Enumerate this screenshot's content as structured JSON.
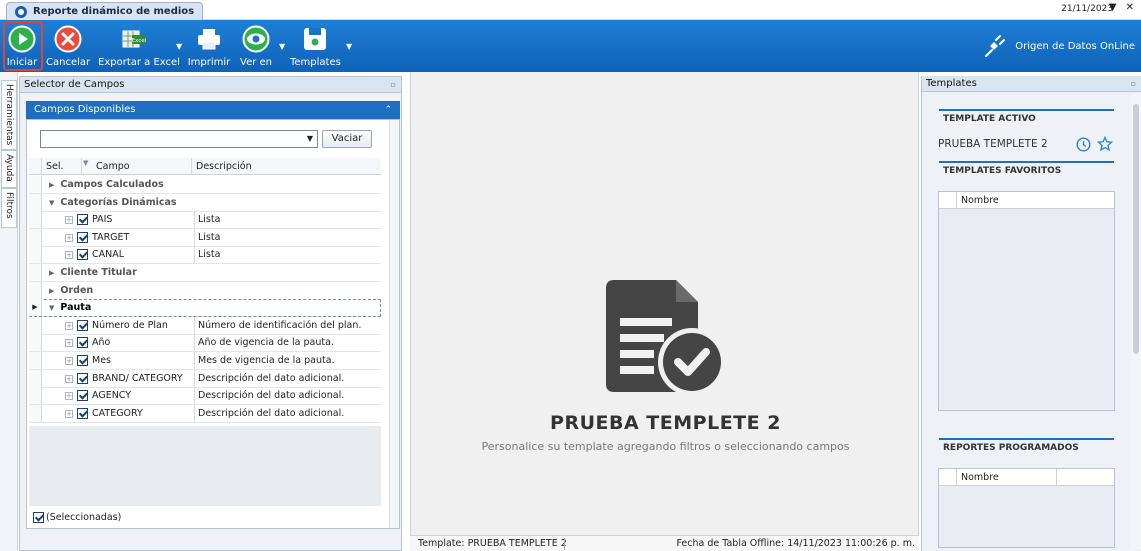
{
  "window": {
    "tab_title": "Reporte dinámico de medios",
    "date": "21/11/2023",
    "controls": "▼ ✕"
  },
  "toolbar": {
    "iniciar": "Iniciar",
    "cancelar": "Cancelar",
    "exportar": "Exportar a Excel",
    "imprimir": "Imprimir",
    "ver_en": "Ver en",
    "templates": "Templates",
    "online": "Origen de Datos OnLine",
    "excel_badge": "Excel"
  },
  "side_tabs": {
    "herramientas": "Herramientas",
    "ayuda": "Ayuda",
    "filtros": "Filtros"
  },
  "selector": {
    "title": "Selector de Campos",
    "section": "Campos Disponibles",
    "combo_value": "",
    "vaciar": "Vaciar",
    "col_sel": "Sel.",
    "col_campo": "Campo",
    "col_desc": "Descripción",
    "seleccionadas": "(Seleccionadas)",
    "rows": [
      {
        "type": "cat",
        "label": "Campos Calculados",
        "open": false
      },
      {
        "type": "cat",
        "label": "Categorías Dinámicas",
        "open": true
      },
      {
        "type": "leaf",
        "name": "PAIS",
        "desc": "Lista"
      },
      {
        "type": "leaf",
        "name": "TARGET",
        "desc": "Lista"
      },
      {
        "type": "leaf",
        "name": "CANAL",
        "desc": "Lista"
      },
      {
        "type": "cat",
        "label": "Cliente Titular",
        "open": false
      },
      {
        "type": "cat",
        "label": "Orden",
        "open": false
      },
      {
        "type": "cat",
        "label": "Pauta",
        "open": true,
        "selected": true
      },
      {
        "type": "leaf",
        "name": "Número de Plan",
        "desc": "Número de identificación del plan."
      },
      {
        "type": "leaf",
        "name": "Año",
        "desc": "Año de vigencia de la pauta."
      },
      {
        "type": "leaf",
        "name": "Mes",
        "desc": "Mes de vigencia de la pauta."
      },
      {
        "type": "leaf",
        "name": "BRAND/ CATEGORY",
        "desc": "Descripción del dato adicional."
      },
      {
        "type": "leaf",
        "name": "AGENCY",
        "desc": "Descripción del dato adicional."
      },
      {
        "type": "leaf",
        "name": "CATEGORY",
        "desc": "Descripción del dato adicional."
      }
    ]
  },
  "center": {
    "title": "PRUEBA TEMPLETE 2",
    "subtitle": "Personalice su template agregando filtros o seleccionando campos"
  },
  "status": {
    "template": "Template: PRUEBA TEMPLETE 2",
    "fecha": "Fecha de Tabla Offline: 14/11/2023 11:00:26 p. m."
  },
  "templates": {
    "title": "Templates",
    "active_head": "TEMPLATE ACTIVO",
    "active_name": "PRUEBA TEMPLETE 2",
    "fav_head": "TEMPLATES FAVORITOS",
    "fav_col": "Nombre",
    "prog_head": "REPORTES PROGRAMADOS",
    "prog_col": "Nombre"
  },
  "colors": {
    "ribbon": "#1a72c8",
    "accent": "#1e6fc2",
    "highlight": "#e0443b"
  }
}
